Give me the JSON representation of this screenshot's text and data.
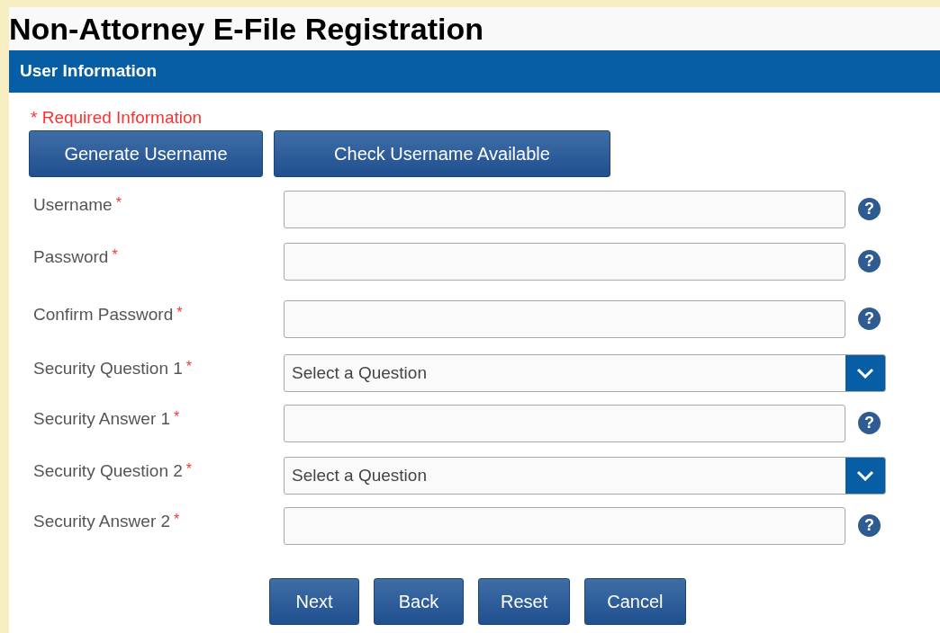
{
  "page_title": "Non-Attorney E-File Registration",
  "section": {
    "title": "User Information",
    "required_note": "* Required Information",
    "top_buttons": [
      "Generate Username",
      "Check Username Available"
    ],
    "fields": [
      {
        "kind": "text",
        "label": "Username",
        "marker": "*",
        "help": "?"
      },
      {
        "kind": "text",
        "label": "Password",
        "marker": "*",
        "help": "?"
      },
      {
        "kind": "text",
        "label": "Confirm Password",
        "marker": "*",
        "help": "?"
      },
      {
        "kind": "select",
        "label": "Security Question 1",
        "marker": "*",
        "value": "Select a Question"
      },
      {
        "kind": "text",
        "label": "Security Answer 1",
        "marker": "*",
        "help": "?"
      },
      {
        "kind": "select",
        "label": "Security Question 2",
        "marker": "*",
        "value": "Select a Question"
      },
      {
        "kind": "text",
        "label": "Security Answer 2",
        "marker": "*",
        "help": "?"
      }
    ],
    "bottom_buttons": [
      "Next",
      "Back",
      "Reset",
      "Cancel"
    ]
  }
}
